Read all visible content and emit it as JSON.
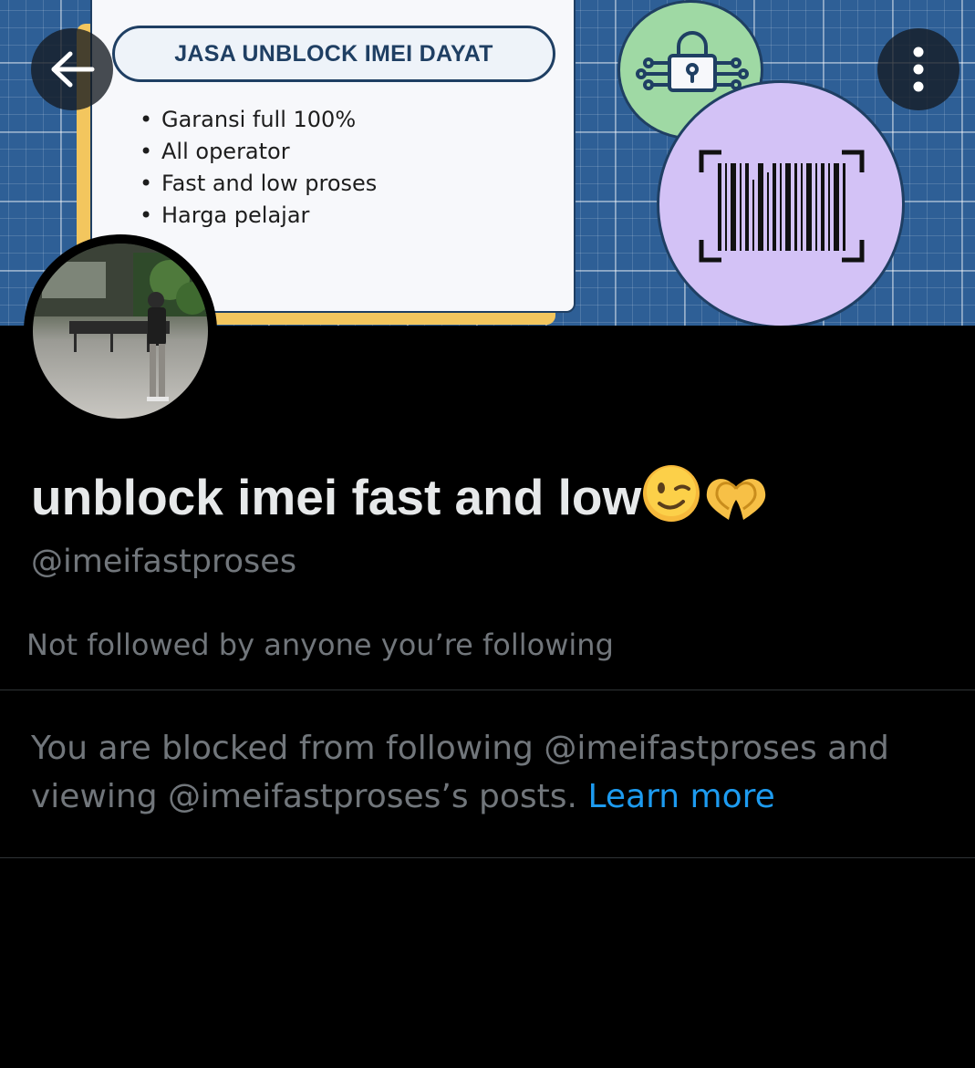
{
  "banner": {
    "title": "JASA UNBLOCK IMEI DAYAT",
    "points": [
      "Garansi full 100%",
      "All operator",
      "Fast and low proses",
      "Harga pelajar"
    ],
    "colors": {
      "background": "#2e5f96",
      "card": "#f7f8fb",
      "accent_yellow": "#f3c65e",
      "lock_circle": "#9fd9a4",
      "barcode_circle": "#d3c2f6"
    }
  },
  "toolbar": {
    "back_icon": "arrow-left-icon",
    "more_icon": "more-vertical-icon"
  },
  "profile": {
    "name": "unblock imei fast and low",
    "name_emojis": [
      "winking-face-emoji",
      "heart-hands-emoji"
    ],
    "handle": "@imeifastproses",
    "followers_note": "Not followed by anyone you’re following"
  },
  "blocked": {
    "message": "You are blocked from following @imeifastproses and viewing @imeifastproses’s posts.",
    "link_label": "Learn more",
    "link_color": "#1d9bf0"
  }
}
